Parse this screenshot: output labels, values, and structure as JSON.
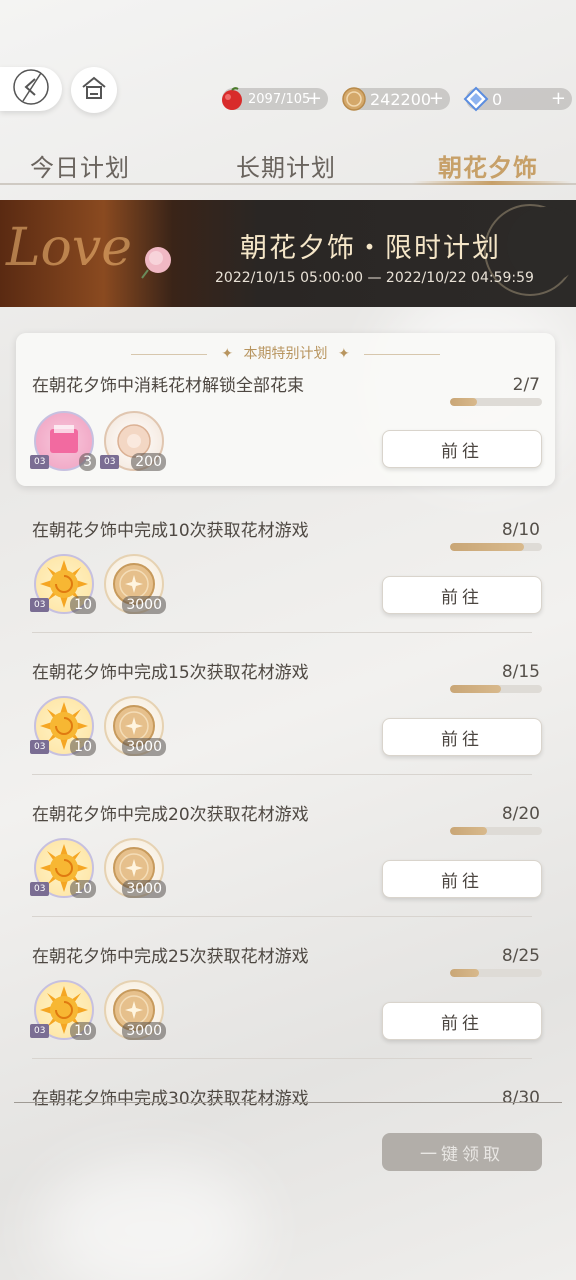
{
  "topbar": {
    "back_icon": "back-arrow-icon",
    "home_icon": "home-icon",
    "resources": [
      {
        "icon": "apple-stamina-icon",
        "value": "2097/105",
        "color": "#d82b2b"
      },
      {
        "icon": "gold-coin-icon",
        "value": "242200",
        "color": "#d4a86a"
      },
      {
        "icon": "diamond-icon",
        "value": "0",
        "color": "#5b8de0"
      }
    ],
    "plus": "+"
  },
  "tabs": [
    {
      "label": "今日计划"
    },
    {
      "label": "长期计划"
    },
    {
      "label": "朝花夕饰",
      "active": true
    }
  ],
  "banner": {
    "decor_text": "Love",
    "title": "朝花夕饰・限时计划",
    "period": "2022/10/15 05:00:00 — 2022/10/22 04:59:59"
  },
  "special": {
    "header": "本期特别计划",
    "star": "✦",
    "task": {
      "title": "在朝花夕饰中消耗花材解锁全部花束",
      "count": "2/7",
      "progress": 0.29,
      "button": "前往",
      "rewards": [
        {
          "icon": "pink-box-icon",
          "tag": "03",
          "qty": "3"
        },
        {
          "icon": "flower-coin-icon",
          "tag": "03",
          "qty": "200"
        }
      ]
    }
  },
  "tasks": [
    {
      "title": "在朝花夕饰中完成10次获取花材游戏",
      "count": "8/10",
      "progress": 0.8,
      "button": "前往",
      "rewards": [
        {
          "icon": "sun-token-icon",
          "tag": "03",
          "qty": "10"
        },
        {
          "icon": "gold-coin-icon",
          "qty": "3000"
        }
      ]
    },
    {
      "title": "在朝花夕饰中完成15次获取花材游戏",
      "count": "8/15",
      "progress": 0.55,
      "button": "前往",
      "rewards": [
        {
          "icon": "sun-token-icon",
          "tag": "03",
          "qty": "10"
        },
        {
          "icon": "gold-coin-icon",
          "qty": "3000"
        }
      ]
    },
    {
      "title": "在朝花夕饰中完成20次获取花材游戏",
      "count": "8/20",
      "progress": 0.4,
      "button": "前往",
      "rewards": [
        {
          "icon": "sun-token-icon",
          "tag": "03",
          "qty": "10"
        },
        {
          "icon": "gold-coin-icon",
          "qty": "3000"
        }
      ]
    },
    {
      "title": "在朝花夕饰中完成25次获取花材游戏",
      "count": "8/25",
      "progress": 0.32,
      "button": "前往",
      "rewards": [
        {
          "icon": "sun-token-icon",
          "tag": "03",
          "qty": "10"
        },
        {
          "icon": "gold-coin-icon",
          "qty": "3000"
        }
      ]
    },
    {
      "title": "在朝花夕饰中完成30次获取花材游戏",
      "count": "8/30"
    }
  ],
  "claim_all": "一键领取"
}
